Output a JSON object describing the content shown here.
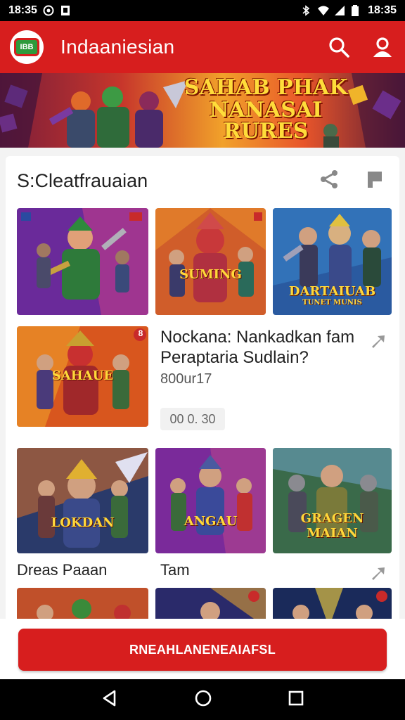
{
  "status_bar": {
    "time_left": "18:35",
    "time_right": "18:35"
  },
  "app_bar": {
    "logo_text": "IBB",
    "title": "Indaaniesian"
  },
  "banner": {
    "title_line1": "SAHAB PHAK",
    "title_line2": "NANASAI RURES"
  },
  "section": {
    "title": "S:Cleatfrauaian"
  },
  "thumbs": [
    {
      "caption": "SUMING",
      "sub": ""
    },
    {
      "caption": "DARTAIUAB",
      "sub": "TUNET MUNIS"
    },
    {
      "caption": "SAHAUE",
      "sub": ""
    },
    {
      "caption": "LOKDAN",
      "sub": ""
    },
    {
      "caption": "ANGAU",
      "sub": ""
    },
    {
      "caption": "GRAGEN",
      "sub": "MAIAN"
    }
  ],
  "featured": {
    "badge": "8",
    "title": "Nockana: Nankadkan fam Peraptaria Sudlain?",
    "meta": "800ur17",
    "chip": "00 0. 30"
  },
  "row_labels": {
    "left": "Dreas Paaan",
    "right": "Tam"
  },
  "cta": {
    "label": "RNEAHLANENEAIAFSL"
  },
  "colors": {
    "brand_red": "#d71e1e",
    "nav_black": "#000000"
  }
}
